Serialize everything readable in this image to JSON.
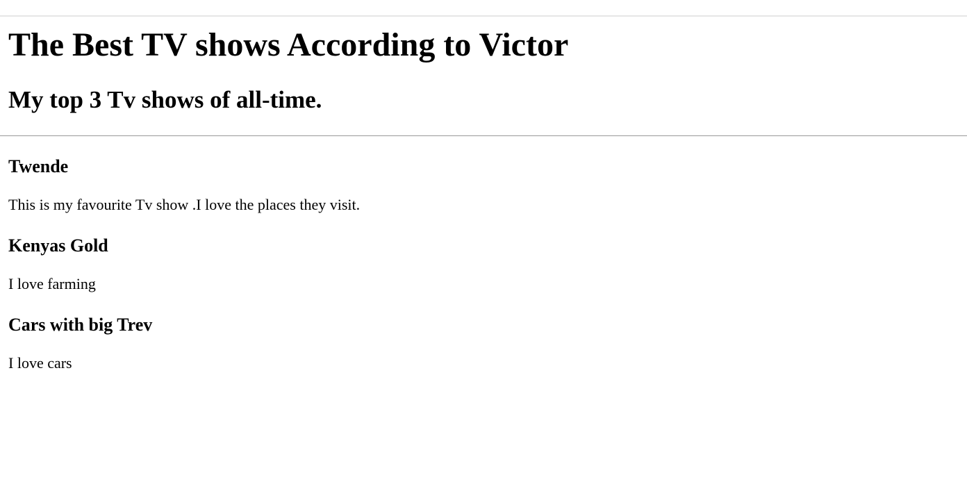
{
  "page": {
    "title": "The Best TV shows According to Victor",
    "subtitle": "My top 3 Tv shows of all-time."
  },
  "shows": [
    {
      "name": "Twende",
      "description": "This is my favourite Tv show .I love the places they visit."
    },
    {
      "name": "Kenyas Gold",
      "description": "I love farming"
    },
    {
      "name": "Cars with big Trev",
      "description": "I love cars"
    }
  ]
}
